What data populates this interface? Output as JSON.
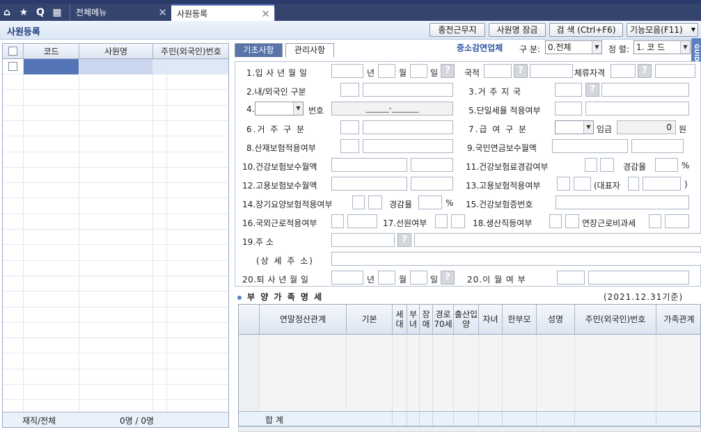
{
  "tabs": [
    {
      "label": "전체메뉴"
    },
    {
      "label": "사원등록"
    }
  ],
  "toolbar": {
    "title": "사원등록",
    "buttons": [
      "종전근무지",
      "사원명 잠금",
      "검  색 (Ctrl+F6)",
      "기능모음(F11)"
    ]
  },
  "left_grid": {
    "headers": [
      "코드",
      "사원명",
      "주민(외국인)번호"
    ],
    "footer_label": "재직/전체",
    "footer_value": "0명 / 0명"
  },
  "right": {
    "tabs": [
      "기초사항",
      "관리사항"
    ],
    "sme_label": "중소감면업체",
    "gubun_label": "구 분:",
    "gubun_value": "0.전체",
    "sort_label": "정 렬:",
    "sort_value": "1. 코  드",
    "guide_label": "GUIDE",
    "form": {
      "hire_date": "1.입 사 년 월 일",
      "year": "년",
      "month": "월",
      "day": "일",
      "nationality": "국적",
      "residence": "체류자격",
      "domestic": "2.내/외국인 구분",
      "country": "3.거  주  지  국",
      "f4": "4.",
      "number": "번호",
      "id_mask": "______-_______",
      "flat_tax": "5.단일세율 적용여부",
      "resident_type": "6.거  주  구  분",
      "pay_type": "7.급  여  구  분",
      "wage": "임금",
      "wage_value": "0",
      "won": "원",
      "industrial": "8.산재보험적용여부",
      "pension": "9.국민연금보수월액",
      "health_pay": "10.건강보험보수월액",
      "health_reduce": "11.건강보험료경감여부",
      "reduce_rate": "경감율",
      "percent": "%",
      "employ_pay": "12.고용보험보수월액",
      "employ_apply": "13.고용보험적용여부",
      "representative": "(대표자",
      "close_paren": ")",
      "ltc": "14.장기요양보험적용여부",
      "ltc_rate": "경감율",
      "health_card": "15.건강보험증번호",
      "overseas": "16.국외근로적용여부",
      "sailor": "17.선원여부",
      "production": "18.생산직등여부",
      "overtime": "연장근로비과세",
      "address": "19.주          소",
      "address_detail": "(상 세 주 소)",
      "leave_date": "20.퇴 사 년 월 일",
      "carry_over": "20.이  월  여  부"
    },
    "dependents": {
      "title": "부 양 가 족 명 세",
      "base_date": "(2021.12.31기준)",
      "headers": [
        "연말정산관계",
        "기본",
        "세대",
        "부녀",
        "장애",
        "경로70세",
        "출산입양",
        "자녀",
        "한부모",
        "성명",
        "주민(외국인)번호",
        "가족관계"
      ],
      "footer_label": "합   계"
    }
  }
}
